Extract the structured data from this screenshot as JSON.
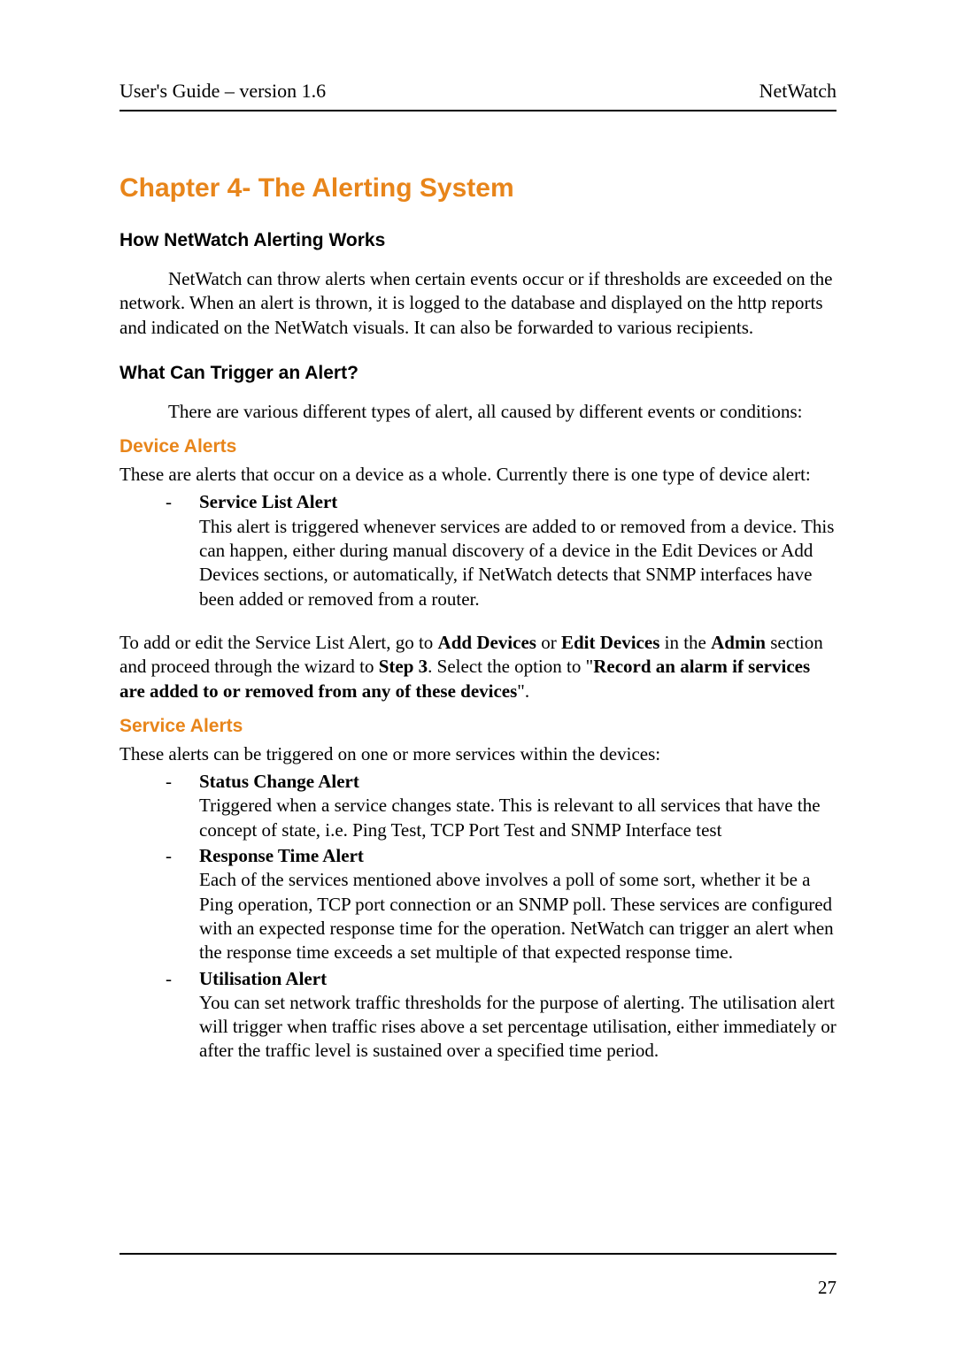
{
  "header": {
    "left": "User's Guide – version 1.6",
    "right": "NetWatch"
  },
  "chapter_title": "Chapter 4- The Alerting System",
  "section1": {
    "title": "How NetWatch Alerting Works",
    "body": "NetWatch can throw alerts when certain events occur or if thresholds are exceeded on the network. When an alert is thrown, it is logged to the database and displayed on the http reports and indicated on the NetWatch visuals. It can also be forwarded to various recipients."
  },
  "section2": {
    "title": "What Can Trigger an Alert?",
    "intro": "There are various different types of alert, all caused by different events or conditions:"
  },
  "device_alerts": {
    "heading": "Device Alerts",
    "intro": "These are alerts that occur on a device as a whole. Currently there is one type of device alert:",
    "item_title": "Service List Alert",
    "item_desc": "This alert is triggered whenever services are added to or removed from a device. This can happen, either during manual discovery of a device in the Edit Devices or Add Devices sections, or automatically, if NetWatch detects that SNMP interfaces have been added or removed from a router.",
    "para_parts": {
      "p1": "To add or edit the Service List Alert, go to ",
      "b1": "Add Devices",
      "p2": " or ",
      "b2": "Edit Devices",
      "p3": " in the ",
      "b3": "Admin",
      "p4": " section and proceed through the wizard to ",
      "b4": "Step 3",
      "p5": ". Select the option to \"",
      "b5": "Record an alarm if services are added to or removed from any of these devices",
      "p6": "\"."
    }
  },
  "service_alerts": {
    "heading": "Service Alerts",
    "intro": "These alerts can be triggered on one or more services within the devices:",
    "items": [
      {
        "title": "Status Change Alert",
        "desc": "Triggered when a service changes state. This is relevant to all services that have the concept of state, i.e. Ping Test, TCP Port Test and SNMP Interface test"
      },
      {
        "title": "Response Time Alert",
        "desc": "Each of the services mentioned above involves a poll of some sort, whether it be a Ping operation, TCP port connection or an SNMP poll. These services are configured with an expected response time for the operation. NetWatch can trigger an alert when the response time exceeds a set multiple of that expected response time."
      },
      {
        "title": "Utilisation Alert",
        "desc": "You can set network traffic thresholds for the purpose of alerting. The utilisation alert will trigger when traffic rises above a set percentage utilisation, either immediately or after the traffic level is sustained over a specified time period."
      }
    ]
  },
  "page_number": "27"
}
